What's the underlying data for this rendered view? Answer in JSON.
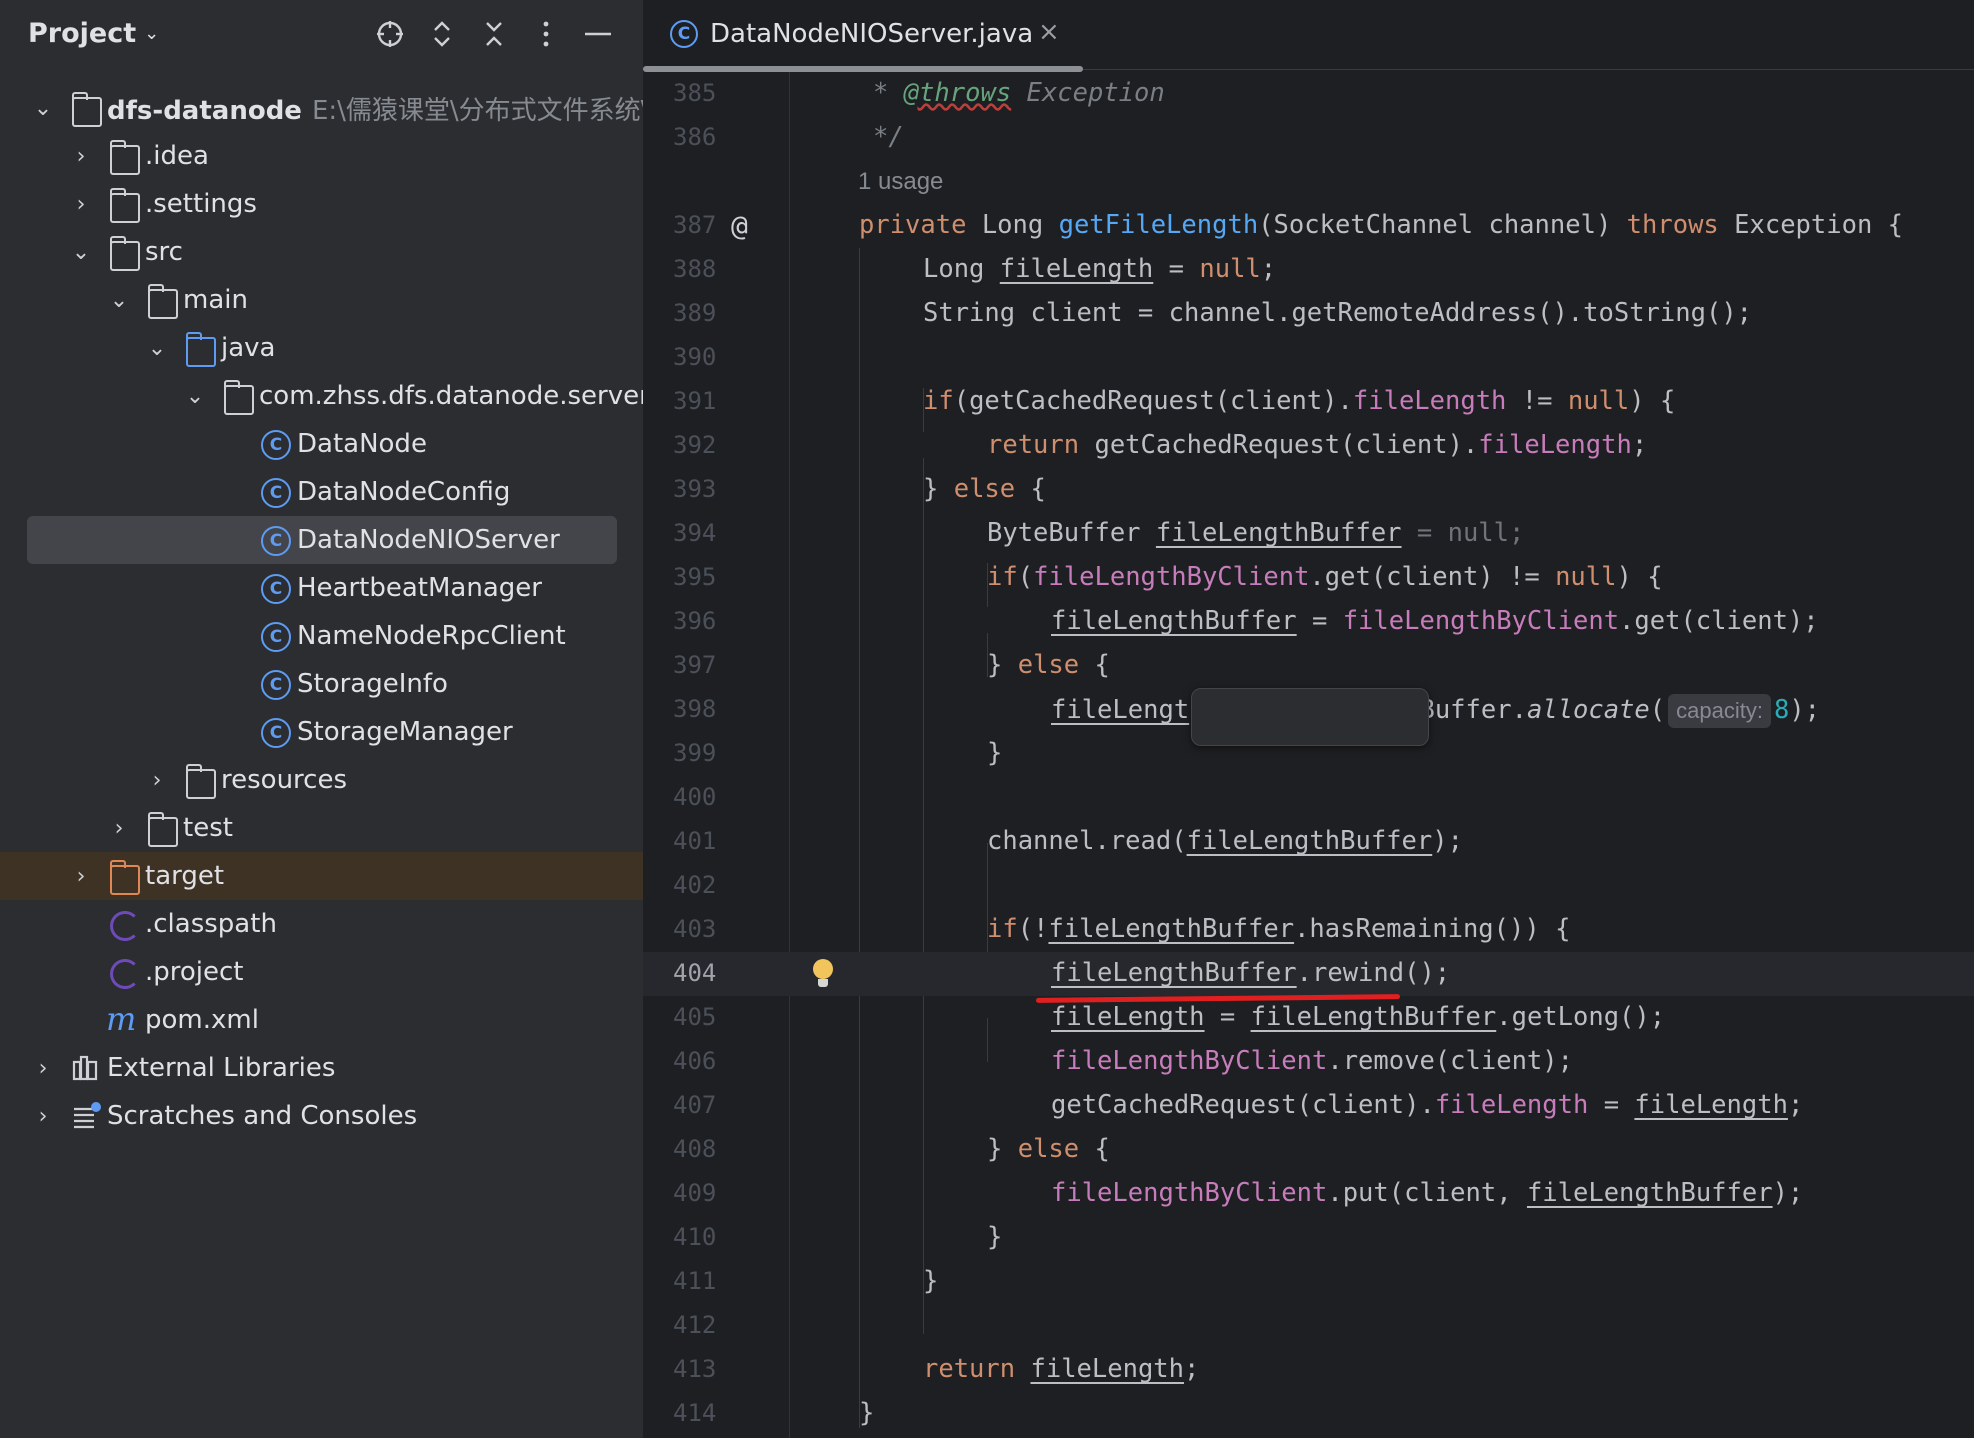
{
  "project": {
    "title": "Project",
    "tree": [
      {
        "label": "dfs-datanode",
        "path": "E:\\儒猿课堂\\分布式文件系统\\",
        "bold": true
      },
      {
        "label": ".idea"
      },
      {
        "label": ".settings"
      },
      {
        "label": "src"
      },
      {
        "label": "main"
      },
      {
        "label": "java"
      },
      {
        "label": "com.zhss.dfs.datanode.server"
      },
      {
        "label": "DataNode"
      },
      {
        "label": "DataNodeConfig"
      },
      {
        "label": "DataNodeNIOServer"
      },
      {
        "label": "HeartbeatManager"
      },
      {
        "label": "NameNodeRpcClient"
      },
      {
        "label": "StorageInfo"
      },
      {
        "label": "StorageManager"
      },
      {
        "label": "resources"
      },
      {
        "label": "test"
      },
      {
        "label": "target"
      },
      {
        "label": ".classpath"
      },
      {
        "label": ".project"
      },
      {
        "label": "pom.xml"
      },
      {
        "label": "External Libraries"
      },
      {
        "label": "Scratches and Consoles"
      }
    ]
  },
  "editor": {
    "tab_label": "DataNodeNIOServer.java",
    "usage_hint": "1 usage",
    "param_hint": "capacity:",
    "current_line": "404",
    "line_numbers": [
      "385",
      "386",
      "387",
      "388",
      "389",
      "390",
      "391",
      "392",
      "393",
      "394",
      "395",
      "396",
      "397",
      "398",
      "399",
      "400",
      "401",
      "402",
      "403",
      "404",
      "405",
      "406",
      "407",
      "408",
      "409",
      "410",
      "411",
      "412",
      "413",
      "414"
    ],
    "code": {
      "l385a": "* ",
      "l385b": "@throws",
      "l385c": " Exception",
      "l386": "*/",
      "l387a": "private",
      "l387b": " Long ",
      "l387c": "getFileLength",
      "l387d": "(SocketChannel channel) ",
      "l387e": "throws",
      "l387f": " Exception {",
      "l388a": "Long ",
      "l388b": "fileLength",
      "l388c": " = ",
      "l388d": "null",
      "l388e": ";",
      "l389": "String client = channel.getRemoteAddress().toString();",
      "l391a": "if",
      "l391b": "(getCachedRequest(client).",
      "l391c": "fileLength",
      "l391d": " != ",
      "l391e": "null",
      "l391f": ") {",
      "l392a": "return",
      "l392b": " getCachedRequest(client).",
      "l392c": "fileLength",
      "l392d": ";",
      "l393a": "} ",
      "l393b": "else",
      "l393c": " {",
      "l394a": "ByteBuffer ",
      "l394b": "fileLengthBuffer",
      "l394c": " = ",
      "l394d": "null",
      "l394e": ";",
      "l395a": "if",
      "l395b": "(",
      "l395c": "fileLengthByClient",
      "l395d": ".get(client) != ",
      "l395e": "null",
      "l395f": ") {",
      "l396a": "fileLengthBuffer",
      "l396b": " = ",
      "l396c": "fileLengthByClient",
      "l396d": ".get(client);",
      "l397a": "} ",
      "l397b": "else",
      "l397c": " {",
      "l398a": "fileLengt",
      "l398gap": "               ",
      "l398b": "Buffer.",
      "l398c": "allocate",
      "l398d": "(",
      "l398e": "8",
      "l398f": ");",
      "l399": "}",
      "l401a": "channel.read(",
      "l401b": "fileLengthBuffer",
      "l401c": ");",
      "l403a": "if",
      "l403b": "(!",
      "l403c": "fileLengthBuffer",
      "l403d": ".hasRemaining()) {",
      "l404a": "fileLengthBuffer",
      "l404b": ".rewind();",
      "l405a": "fileLength",
      "l405b": " = ",
      "l405c": "fileLengthBuffer",
      "l405d": ".getLong();",
      "l406a": "fileLengthByClient",
      "l406b": ".remove(client);",
      "l407a": "getCachedRequest(client).",
      "l407b": "fileLength",
      "l407c": " = ",
      "l407d": "fileLength",
      "l407e": ";",
      "l408a": "} ",
      "l408b": "else",
      "l408c": " {",
      "l409a": "fileLengthByClient",
      "l409b": ".put(client, ",
      "l409c": "fileLengthBuffer",
      "l409d": ");",
      "l410": "}",
      "l411": "}",
      "l413a": "return",
      "l413b": " ",
      "l413c": "fileLength",
      "l413d": ";",
      "l414": "}"
    }
  },
  "colors": {
    "keyword": "#cf8e6d",
    "method": "#56a8f5",
    "field": "#c77dbb",
    "number": "#2aacb8",
    "comment": "#7a7e85",
    "class_icon": "#5e9bf3",
    "annotation_mark": "#e02020"
  },
  "icons": [
    "chevron-down-icon",
    "locate-icon",
    "expand-all-icon",
    "collapse-all-icon",
    "more-icon",
    "minimize-icon",
    "folder-icon",
    "package-icon",
    "class-icon",
    "eclipse-icon",
    "maven-icon",
    "library-icon",
    "scratches-icon",
    "close-icon",
    "implements-icon",
    "bulb-icon"
  ]
}
